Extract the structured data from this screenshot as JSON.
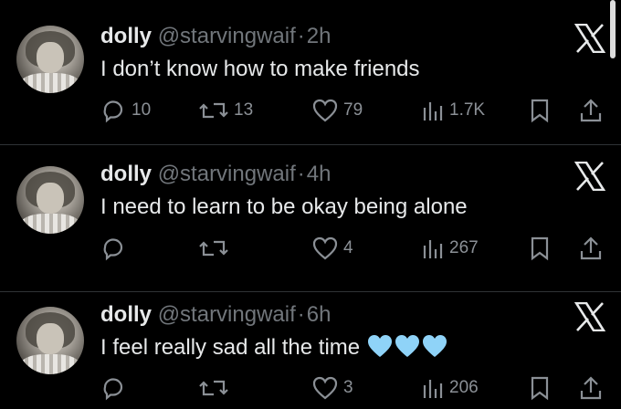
{
  "tweets": [
    {
      "name": "dolly",
      "handle": "@starvingwaif",
      "separator": "·",
      "time": "2h",
      "text": "I don’t know how to make friends",
      "replies": "10",
      "retweets": "13",
      "likes": "79",
      "views": "1.7K"
    },
    {
      "name": "dolly",
      "handle": "@starvingwaif",
      "separator": "·",
      "time": "4h",
      "text": "I need to learn to be okay being alone",
      "replies": "",
      "retweets": "",
      "likes": "4",
      "views": "267"
    },
    {
      "name": "dolly",
      "handle": "@starvingwaif",
      "separator": "·",
      "time": "6h",
      "text": "I feel really sad all the time",
      "replies": "",
      "retweets": "",
      "likes": "3",
      "views": "206"
    }
  ],
  "icons": {
    "reply": "reply-icon",
    "retweet": "retweet-icon",
    "like": "heart-icon",
    "views": "views-icon",
    "bookmark": "bookmark-icon",
    "share": "share-icon",
    "x": "x-logo-icon",
    "emoji": "light-blue-heart-icon"
  },
  "colors": {
    "background": "#000000",
    "text": "#e7e9ea",
    "secondary": "#71767b",
    "divider": "#2f3336",
    "emoji_heart": "#8fd3f8"
  }
}
